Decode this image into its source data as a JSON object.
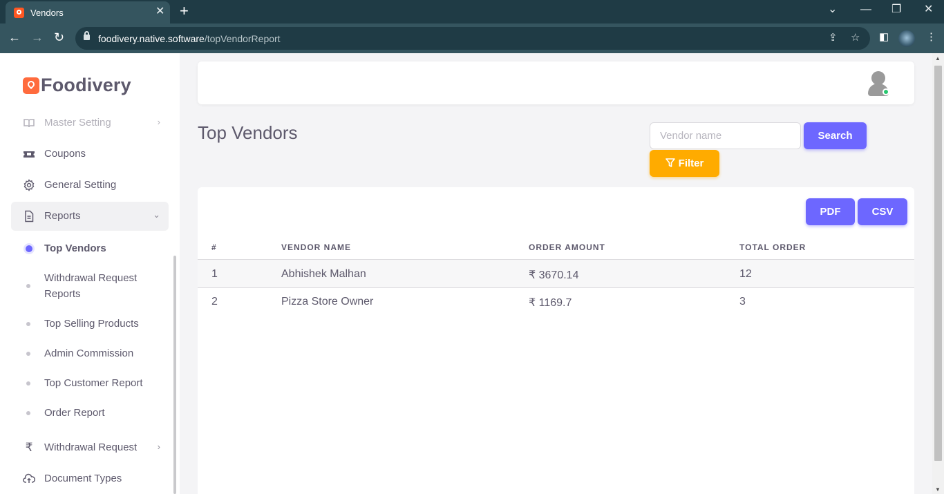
{
  "browser": {
    "tab_title": "Vendors",
    "url_domain": "foodivery.native.software",
    "url_path": "/topVendorReport"
  },
  "brand": {
    "name": "Foodivery"
  },
  "sidebar": {
    "items": [
      {
        "label": "Master Setting",
        "icon": "book-icon"
      },
      {
        "label": "Coupons",
        "icon": "ticket-icon"
      },
      {
        "label": "General Setting",
        "icon": "gear-icon"
      },
      {
        "label": "Reports",
        "icon": "document-icon"
      }
    ],
    "report_subitems": [
      {
        "label": "Top Vendors",
        "active": true
      },
      {
        "label": "Withdrawal Request Reports"
      },
      {
        "label": "Top Selling Products"
      },
      {
        "label": "Admin Commission"
      },
      {
        "label": "Top Customer Report"
      },
      {
        "label": "Order Report"
      }
    ],
    "bottom_items": [
      {
        "label": "Withdrawal Request",
        "icon": "rupee-icon"
      },
      {
        "label": "Document Types",
        "icon": "cloud-upload-icon"
      }
    ]
  },
  "page": {
    "title": "Top Vendors",
    "search_placeholder": "Vendor name",
    "search_label": "Search",
    "filter_label": "Filter",
    "pdf_label": "PDF",
    "csv_label": "CSV"
  },
  "table": {
    "headers": [
      "#",
      "VENDOR NAME",
      "ORDER AMOUNT",
      "TOTAL ORDER"
    ],
    "rows": [
      {
        "index": "1",
        "vendor": "Abhishek Malhan",
        "amount": "₹ 3670.14",
        "orders": "12"
      },
      {
        "index": "2",
        "vendor": "Pizza Store Owner",
        "amount": "₹ 1169.7",
        "orders": "3"
      }
    ]
  },
  "colors": {
    "primary": "#6d67ff",
    "warning": "#ffab00",
    "brand": "#ff6b3d",
    "online": "#28c76f"
  }
}
